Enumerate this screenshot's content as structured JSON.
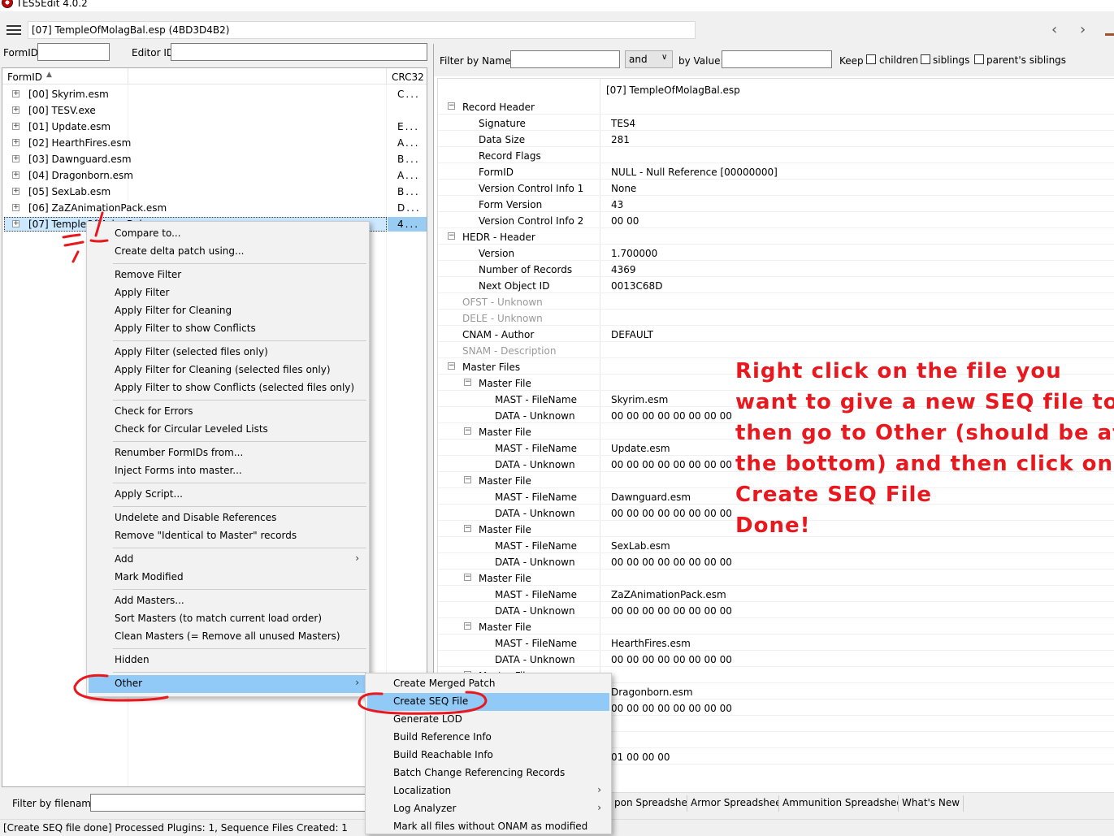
{
  "window": {
    "title": "TES5Edit 4.0.2"
  },
  "path_bar": {
    "value": "[07] TempleOfMolagBal.esp (4BD3D4B2)"
  },
  "left_filters": {
    "formid_label": "FormID",
    "editorid_label": "Editor ID"
  },
  "tree": {
    "col_formid": "FormID",
    "col_crc": "CRC32",
    "rows": [
      {
        "name": "[00] Skyrim.esm",
        "crc": "C..."
      },
      {
        "name": "[00] TESV.exe",
        "crc": ""
      },
      {
        "name": "[01] Update.esm",
        "crc": "E..."
      },
      {
        "name": "[02] HearthFires.esm",
        "crc": "A..."
      },
      {
        "name": "[03] Dawnguard.esm",
        "crc": "B..."
      },
      {
        "name": "[04] Dragonborn.esm",
        "crc": "A..."
      },
      {
        "name": "[05] SexLab.esm",
        "crc": "B..."
      },
      {
        "name": "[06] ZaZAnimationPack.esm",
        "crc": "D..."
      },
      {
        "name": "[07] TempleOfMolagBal.esp",
        "crc": "4..."
      }
    ]
  },
  "right_filter": {
    "filter_name_label": "Filter by Name:",
    "op_value": "and",
    "filter_value_label": "by Value:",
    "keep_label": "Keep",
    "children_label": "children",
    "siblings_label": "siblings",
    "parents_siblings_label": "parent's siblings"
  },
  "record_view": {
    "file_header": "[07] TempleOfMolagBal.esp",
    "rows": [
      {
        "name": "Record Header",
        "value": "",
        "level": 0,
        "exp": true
      },
      {
        "name": "Signature",
        "value": "TES4",
        "level": 1
      },
      {
        "name": "Data Size",
        "value": "281",
        "level": 1
      },
      {
        "name": "Record Flags",
        "value": "",
        "level": 1
      },
      {
        "name": "FormID",
        "value": "NULL - Null Reference [00000000]",
        "level": 1
      },
      {
        "name": "Version Control Info 1",
        "value": "None",
        "level": 1
      },
      {
        "name": "Form Version",
        "value": "43",
        "level": 1
      },
      {
        "name": "Version Control Info 2",
        "value": "00 00",
        "level": 1
      },
      {
        "name": "HEDR - Header",
        "value": "",
        "level": 0,
        "exp": true
      },
      {
        "name": "Version",
        "value": "1.700000",
        "level": 1
      },
      {
        "name": "Number of Records",
        "value": "4369",
        "level": 1
      },
      {
        "name": "Next Object ID",
        "value": "0013C68D",
        "level": 1
      },
      {
        "name": "OFST - Unknown",
        "value": "",
        "level": 0,
        "grey": true
      },
      {
        "name": "DELE - Unknown",
        "value": "",
        "level": 0,
        "grey": true
      },
      {
        "name": "CNAM - Author",
        "value": "DEFAULT",
        "level": 0
      },
      {
        "name": "SNAM - Description",
        "value": "",
        "level": 0,
        "grey": true
      },
      {
        "name": "Master Files",
        "value": "",
        "level": 0,
        "exp": true
      },
      {
        "name": "Master File",
        "value": "",
        "level": 1,
        "exp": true
      },
      {
        "name": "MAST - FileName",
        "value": "Skyrim.esm",
        "level": 2
      },
      {
        "name": "DATA - Unknown",
        "value": "00 00 00 00 00 00 00 00",
        "level": 2
      },
      {
        "name": "Master File",
        "value": "",
        "level": 1,
        "exp": true
      },
      {
        "name": "MAST - FileName",
        "value": "Update.esm",
        "level": 2
      },
      {
        "name": "DATA - Unknown",
        "value": "00 00 00 00 00 00 00 00",
        "level": 2
      },
      {
        "name": "Master File",
        "value": "",
        "level": 1,
        "exp": true
      },
      {
        "name": "MAST - FileName",
        "value": "Dawnguard.esm",
        "level": 2
      },
      {
        "name": "DATA - Unknown",
        "value": "00 00 00 00 00 00 00 00",
        "level": 2
      },
      {
        "name": "Master File",
        "value": "",
        "level": 1,
        "exp": true
      },
      {
        "name": "MAST - FileName",
        "value": "SexLab.esm",
        "level": 2
      },
      {
        "name": "DATA - Unknown",
        "value": "00 00 00 00 00 00 00 00",
        "level": 2
      },
      {
        "name": "Master File",
        "value": "",
        "level": 1,
        "exp": true
      },
      {
        "name": "MAST - FileName",
        "value": "ZaZAnimationPack.esm",
        "level": 2
      },
      {
        "name": "DATA - Unknown",
        "value": "00 00 00 00 00 00 00 00",
        "level": 2
      },
      {
        "name": "Master File",
        "value": "",
        "level": 1,
        "exp": true
      },
      {
        "name": "MAST - FileName",
        "value": "HearthFires.esm",
        "level": 2
      },
      {
        "name": "DATA - Unknown",
        "value": "00 00 00 00 00 00 00 00",
        "level": 2
      },
      {
        "name": "Master File",
        "value": "",
        "level": 1,
        "exp": true
      },
      {
        "name": "",
        "value": "Dragonborn.esm",
        "level": 2
      },
      {
        "name": "",
        "value": "00 00 00 00 00 00 00 00",
        "level": 2
      },
      {
        "name": "",
        "value": "",
        "level": 0
      },
      {
        "name": "",
        "value": "",
        "level": 0
      },
      {
        "name": "",
        "value": "01 00 00 00",
        "level": 0
      }
    ]
  },
  "context_menu": {
    "items": [
      "Compare to...",
      "Create delta patch using...",
      "-",
      "Remove Filter",
      "Apply Filter",
      "Apply Filter for Cleaning",
      "Apply Filter to show Conflicts",
      "-",
      "Apply Filter (selected files only)",
      "Apply Filter for Cleaning (selected files only)",
      "Apply Filter to show Conflicts (selected files only)",
      "-",
      "Check for Errors",
      "Check for Circular Leveled Lists",
      "-",
      "Renumber FormIDs from...",
      "Inject Forms into master...",
      "-",
      "Apply Script...",
      "-",
      "Undelete and Disable References",
      "Remove \"Identical to Master\" records",
      "-",
      "Add",
      "Mark Modified",
      "-",
      "Add Masters...",
      "Sort Masters (to match current load order)",
      "Clean Masters (= Remove all unused Masters)",
      "-",
      "Hidden",
      "-",
      "Other"
    ]
  },
  "submenu": {
    "items": [
      "Create Merged Patch",
      "Create SEQ File",
      "Generate LOD",
      "Build Reference Info",
      "Build Reachable Info",
      "Batch Change Referencing Records",
      "Localization",
      "Log Analyzer",
      "Mark all files without ONAM as modified"
    ]
  },
  "bottom": {
    "filter_filename_label": "Filter by filename:",
    "tabs": [
      "pon Spreadsheet",
      "Armor Spreadsheet",
      "Ammunition Spreadsheet",
      "What's New"
    ],
    "status": "[Create SEQ file done] Processed Plugins: 1, Sequence Files Created: 1"
  },
  "annotation": {
    "lines": [
      "Right click on the file you",
      "want to give a new SEQ file to,",
      "then go to Other (should be at",
      "the bottom) and then click on",
      "Create SEQ File",
      "Done!"
    ],
    "color": "#e8181e"
  },
  "colors": {
    "selection": "#91c9f7",
    "tree_selected": "#cce8ff",
    "annotation": "#e8181e"
  }
}
